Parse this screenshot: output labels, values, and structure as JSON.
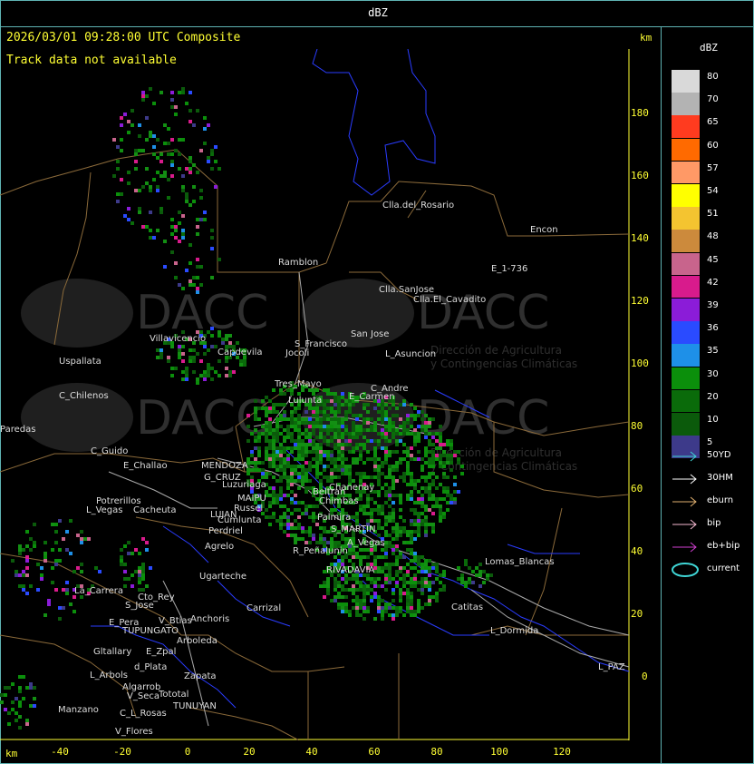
{
  "header": {
    "title": "dBZ"
  },
  "map": {
    "title_line": "2026/03/01 09:28:00 UTC Composite",
    "status_line": "Track data not available",
    "km_label_top": "km",
    "km_label_bottom": "km",
    "y_ticks": [
      "180",
      "160",
      "140",
      "120",
      "100",
      "80",
      "60",
      "40",
      "20",
      "0"
    ],
    "x_ticks": [
      "-40",
      "-20",
      "0",
      "20",
      "40",
      "60",
      "80",
      "100",
      "120"
    ],
    "watermark_text": "DACC",
    "watermark_line1": "Dirección de Agricultura",
    "watermark_line2": "y Contingencias Climáticas",
    "places": [
      "Clla.del_Rosario",
      "Encon",
      "Rامblon",
      "E_1-736",
      "Clla.SanJose",
      "Clla.El_Cavadito",
      "Villavicencio",
      "Capdevila",
      "S_Francisco",
      "San Jose",
      "L_Asuncion",
      "Uspallata",
      "Tres_Mayo",
      "Lulunta",
      "C_Andre",
      "C_Chilenos",
      "Paredas",
      "Jocoli",
      "E_Carmen",
      "C_Guido",
      "E_Challao",
      "MENDOZA",
      "G_CRUZ",
      "Luzuriaga",
      "Beltran",
      "Chanenay",
      "Potrerillos",
      "L_Vegas",
      "Cacheuta",
      "MAIPU",
      "Russel",
      "LUJAN",
      "Cumlunta",
      "Perdriel",
      "Agrelo",
      "Chimbas",
      "S_MARTIN",
      "Palmira",
      "R_Peñalunin",
      "A_Vegas",
      "Ugarteche",
      "RIVADAVIA",
      "Lomas_Blancas",
      "La_Carrera",
      "Cto_Rey",
      "S_Jose",
      "Carrizal",
      "Anchoris",
      "Catitas",
      "E_Pera",
      "V_Btias",
      "TUPUNGATO",
      "Arboleda",
      "L_Dormida",
      "Gltallary",
      "E_Zpal",
      "d_Plata",
      "L_Arbols",
      "Algarrob",
      "Zapata",
      "Tototal",
      "V_Seca",
      "TUNUYAN",
      "Manzano",
      "C_L_Rosas",
      "V_Flores",
      "L_PAZ"
    ]
  },
  "legend": {
    "title": "dBZ",
    "levels": [
      {
        "label": "80",
        "color": "#d9d9d9"
      },
      {
        "label": "70",
        "color": "#b3b3b3"
      },
      {
        "label": "65",
        "color": "#ff3b1f"
      },
      {
        "label": "60",
        "color": "#ff6a00"
      },
      {
        "label": "57",
        "color": "#ff9966"
      },
      {
        "label": "54",
        "color": "#ffff00"
      },
      {
        "label": "51",
        "color": "#f4c430"
      },
      {
        "label": "48",
        "color": "#cc8a3c"
      },
      {
        "label": "45",
        "color": "#c8648c"
      },
      {
        "label": "42",
        "color": "#d81b8c"
      },
      {
        "label": "39",
        "color": "#8b1cd8"
      },
      {
        "label": "36",
        "color": "#2a4bff"
      },
      {
        "label": "35",
        "color": "#1e90e8"
      },
      {
        "label": "30",
        "color": "#0b8f0b"
      },
      {
        "label": "20",
        "color": "#0a6b0a"
      },
      {
        "label": "10",
        "color": "#0b5a0b"
      },
      {
        "label": "5",
        "color": "#3d3a8a"
      }
    ],
    "tracks": [
      {
        "label": "50YD",
        "color": "#3fd4d4"
      },
      {
        "label": "30HM",
        "color": "#ffffff"
      },
      {
        "label": "eburn",
        "color": "#e0b070"
      },
      {
        "label": "bip",
        "color": "#f4b8d0"
      },
      {
        "label": "eb+bip",
        "color": "#d040d0"
      },
      {
        "label": "current",
        "color": "#3fd4d4"
      }
    ]
  }
}
